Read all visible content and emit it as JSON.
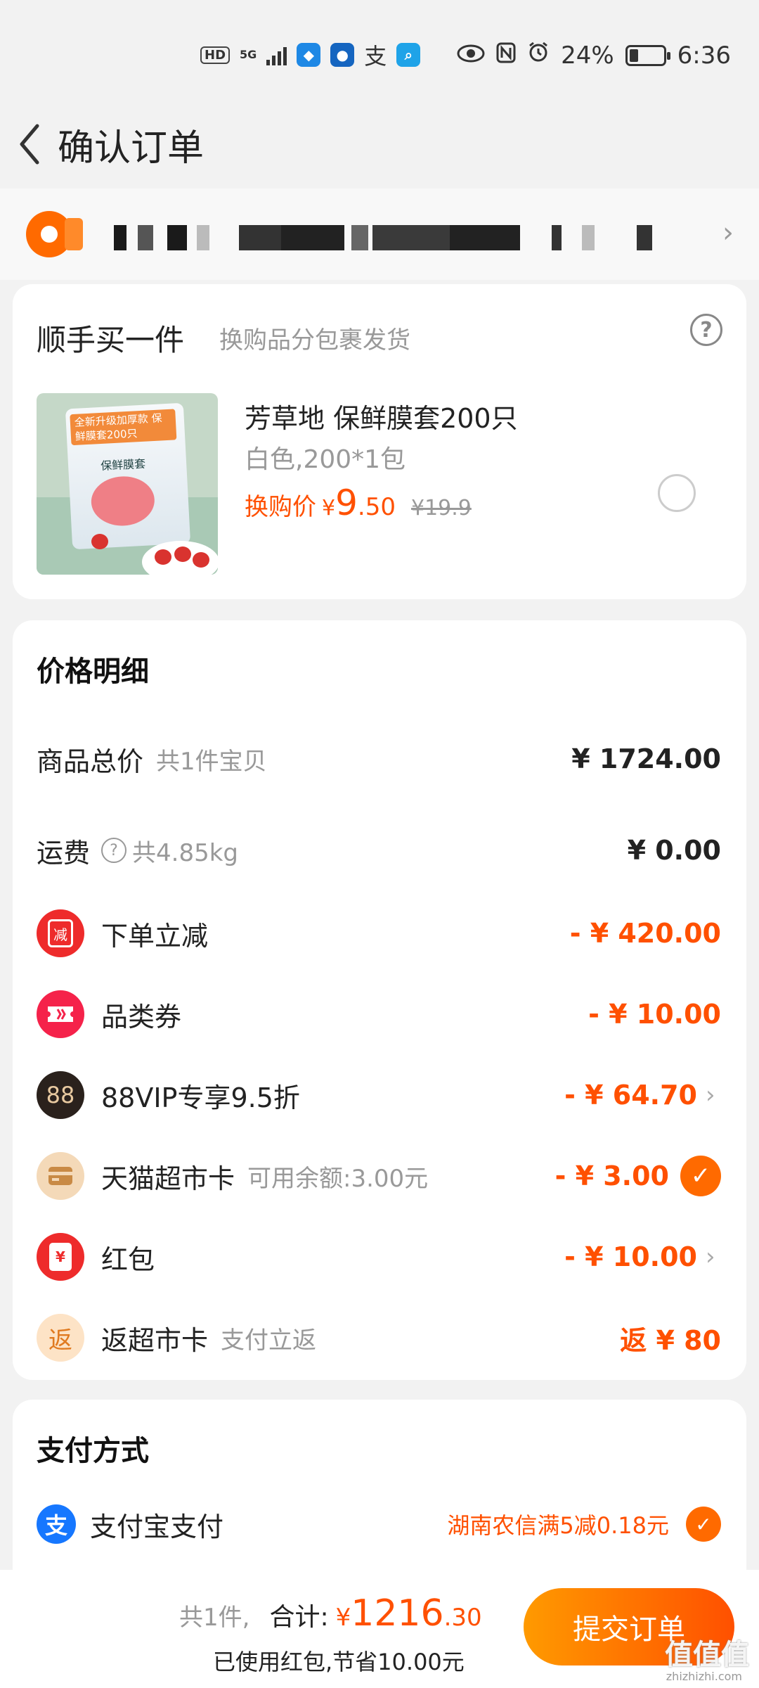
{
  "status_bar": {
    "hd": "HD",
    "network": "5G",
    "alipay_glyph": "支",
    "battery": "24%",
    "time": "6:36"
  },
  "nav": {
    "title": "确认订单",
    "back_icon": "chevron-left-icon"
  },
  "address": {
    "chevron": "›"
  },
  "exchange": {
    "title": "顺手买一件",
    "subtitle": "换购品分包裹发货",
    "help": "?",
    "product": {
      "name": "芳草地 保鲜膜套200只",
      "spec": "白色,200*1包",
      "price_label": "换购价",
      "yen": "¥",
      "price_int": "9",
      "price_dec": ".50",
      "original_price": "¥19.9",
      "image_tag": "全新升级加厚款 保鲜膜套200只",
      "image_label": "保鲜膜套"
    }
  },
  "price_detail": {
    "title": "价格明细",
    "rows": [
      {
        "label": "商品总价",
        "sub": "共1件宝贝",
        "value": "¥ 1724.00"
      },
      {
        "label": "运费",
        "sub": "共4.85kg",
        "value": "¥ 0.00"
      },
      {
        "label": "下单立减",
        "icon_text": "减",
        "value": "- ¥ 420.00"
      },
      {
        "label": "品类券",
        "value": "- ¥ 10.00"
      },
      {
        "label": "88VIP专享9.5折",
        "icon_text": "88",
        "value": "- ¥ 64.70",
        "chevron": "›"
      },
      {
        "label": "天猫超市卡",
        "sub": "可用余额:3.00元",
        "value": "- ¥ 3.00",
        "check": "✓"
      },
      {
        "label": "红包",
        "icon_text": "¥",
        "value": "- ¥ 10.00",
        "chevron": "›"
      },
      {
        "label": "返超市卡",
        "sub": "支付立返",
        "icon_text": "返",
        "value": "返 ¥ 80"
      }
    ]
  },
  "payment": {
    "title": "支付方式",
    "method": "支付宝支付",
    "icon_text": "支",
    "promo": "湖南农信满5减0.18元",
    "check": "✓"
  },
  "bottom": {
    "count": "共1件,",
    "total_label": "合计:",
    "yen": "¥",
    "total_int": "1216",
    "total_dec": ".30",
    "savings": "已使用红包,节省10.00元",
    "submit": "提交订单",
    "watermark": "值值值",
    "watermark_sub": "zhizhizhi.com"
  },
  "colors": {
    "accent": "#ff5000",
    "background": "#f2f2f2"
  }
}
